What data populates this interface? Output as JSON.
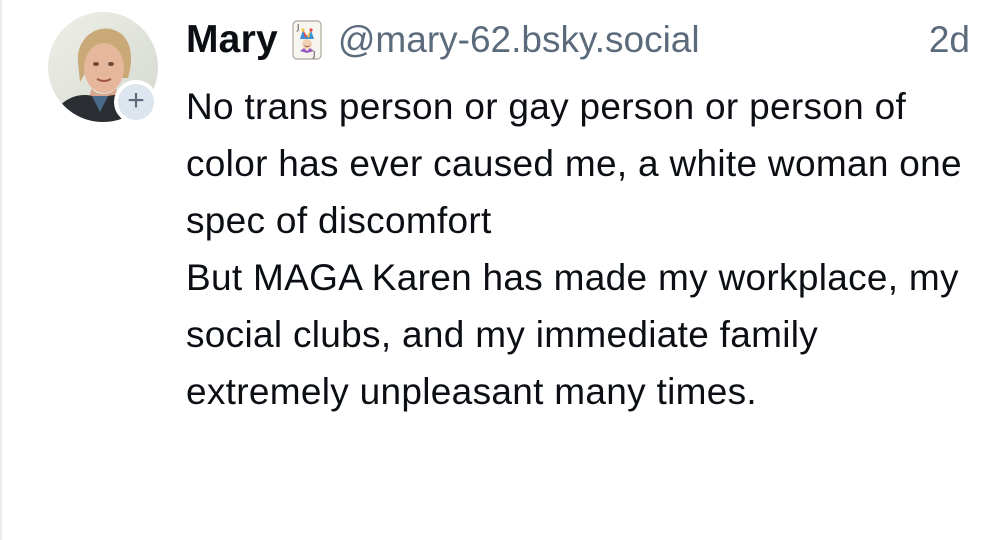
{
  "post": {
    "author": {
      "display_name": "Mary",
      "handle": "@mary-62.bsky.social",
      "badge_icon": "joker-playing-card-icon",
      "avatar": "profile-photo-icon"
    },
    "timestamp": "2d",
    "follow_label": "+",
    "body": {
      "paragraph_1": "No trans person or gay person or person of color has ever caused me, a white woman one spec of discomfort",
      "paragraph_2": "But MAGA Karen has made my workplace, my social clubs, and my immediate family extremely unpleasant many times."
    }
  },
  "colors": {
    "text": "#0b0f14",
    "muted": "#5b6b7c",
    "badge_bg": "#dde5ee",
    "background": "#ffffff"
  }
}
